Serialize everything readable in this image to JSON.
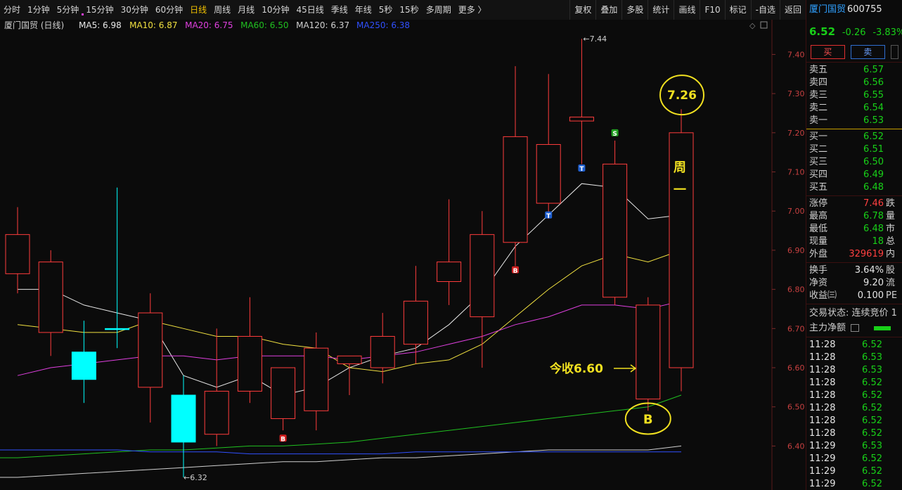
{
  "toolbar": {
    "periods": [
      "分时",
      "1分钟",
      "5分钟",
      "15分钟",
      "30分钟",
      "60分钟",
      "日线",
      "周线",
      "月线",
      "10分钟",
      "45日线",
      "季线",
      "年线",
      "5秒",
      "15秒",
      "多周期",
      "更多 〉"
    ],
    "active_period": "日线",
    "tools": [
      "复权",
      "叠加",
      "多股",
      "统计",
      "画线",
      "F10",
      "标记",
      "-自选",
      "返回"
    ]
  },
  "chart_header": {
    "title": "厦门国贸 (日线)",
    "ma": [
      {
        "label": "MA5: 6.98",
        "color": "#e8e8e8"
      },
      {
        "label": "MA10: 6.87",
        "color": "#f0e040"
      },
      {
        "label": "MA20: 6.75",
        "color": "#e040e0"
      },
      {
        "label": "MA60: 6.50",
        "color": "#20c020"
      },
      {
        "label": "MA120: 6.37",
        "color": "#d0d0d0"
      },
      {
        "label": "MA250: 6.38",
        "color": "#3050ff"
      }
    ]
  },
  "chart_data": {
    "type": "candlestick",
    "y_ticks": [
      "7.40",
      "7.30",
      "7.20",
      "7.10",
      "7.00",
      "6.90",
      "6.80",
      "6.70",
      "6.60",
      "6.50",
      "6.40"
    ],
    "ylim": [
      6.32,
      7.46
    ],
    "candles": [
      {
        "o": 6.84,
        "h": 7.01,
        "l": 6.79,
        "c": 6.94
      },
      {
        "o": 6.69,
        "h": 6.9,
        "l": 6.63,
        "c": 6.87
      },
      {
        "o": 6.64,
        "h": 6.72,
        "l": 6.51,
        "c": 6.57
      },
      {
        "o": 6.7,
        "h": 7.06,
        "l": 6.65,
        "c": 6.7
      },
      {
        "o": 6.55,
        "h": 6.79,
        "l": 6.46,
        "c": 6.74
      },
      {
        "o": 6.53,
        "h": 6.58,
        "l": 6.32,
        "c": 6.41
      },
      {
        "o": 6.43,
        "h": 6.7,
        "l": 6.4,
        "c": 6.54
      },
      {
        "o": 6.54,
        "h": 6.78,
        "l": 6.51,
        "c": 6.68
      },
      {
        "o": 6.47,
        "h": 6.6,
        "l": 6.44,
        "c": 6.6
      },
      {
        "o": 6.49,
        "h": 6.69,
        "l": 6.44,
        "c": 6.65
      },
      {
        "o": 6.61,
        "h": 6.63,
        "l": 6.53,
        "c": 6.63
      },
      {
        "o": 6.6,
        "h": 6.74,
        "l": 6.56,
        "c": 6.68
      },
      {
        "o": 6.66,
        "h": 6.86,
        "l": 6.61,
        "c": 6.77
      },
      {
        "o": 6.82,
        "h": 7.03,
        "l": 6.76,
        "c": 6.87
      },
      {
        "o": 6.73,
        "h": 7.0,
        "l": 6.6,
        "c": 6.94
      },
      {
        "o": 6.92,
        "h": 7.37,
        "l": 6.86,
        "c": 7.19
      },
      {
        "o": 7.02,
        "h": 7.35,
        "l": 6.98,
        "c": 7.17
      },
      {
        "o": 7.23,
        "h": 7.44,
        "l": 7.12,
        "c": 7.24
      },
      {
        "o": 6.78,
        "h": 7.18,
        "l": 6.76,
        "c": 7.12
      },
      {
        "o": 6.52,
        "h": 6.78,
        "l": 6.49,
        "c": 6.76
      },
      {
        "o": 6.6,
        "h": 7.26,
        "l": 6.54,
        "c": 7.2
      }
    ],
    "ma_series": [
      {
        "name": "MA5",
        "color": "#e8e8e8",
        "values": [
          6.8,
          6.8,
          6.76,
          6.74,
          6.72,
          6.58,
          6.55,
          6.58,
          6.53,
          6.55,
          6.6,
          6.63,
          6.65,
          6.71,
          6.79,
          6.91,
          6.99,
          7.07,
          7.06,
          6.98,
          6.99
        ]
      },
      {
        "name": "MA10",
        "color": "#f0e040",
        "values": [
          6.71,
          6.7,
          6.69,
          6.69,
          6.72,
          6.7,
          6.68,
          6.68,
          6.66,
          6.65,
          6.6,
          6.59,
          6.61,
          6.62,
          6.66,
          6.73,
          6.8,
          6.86,
          6.89,
          6.87,
          6.9
        ]
      },
      {
        "name": "MA20",
        "color": "#e040e0",
        "values": [
          6.58,
          6.6,
          6.61,
          6.62,
          6.63,
          6.63,
          6.62,
          6.63,
          6.63,
          6.63,
          6.62,
          6.63,
          6.64,
          6.66,
          6.68,
          6.71,
          6.73,
          6.76,
          6.76,
          6.75,
          6.77
        ]
      },
      {
        "name": "MA60",
        "color": "#20c020",
        "values": [
          6.37,
          6.375,
          6.38,
          6.385,
          6.39,
          6.39,
          6.395,
          6.4,
          6.4,
          6.405,
          6.41,
          6.42,
          6.43,
          6.44,
          6.45,
          6.46,
          6.47,
          6.48,
          6.49,
          6.5,
          6.53
        ]
      },
      {
        "name": "MA120",
        "color": "#d0d0d0",
        "values": [
          6.32,
          6.325,
          6.33,
          6.335,
          6.34,
          6.345,
          6.35,
          6.355,
          6.36,
          6.36,
          6.365,
          6.37,
          6.37,
          6.375,
          6.38,
          6.385,
          6.39,
          6.39,
          6.39,
          6.39,
          6.4
        ]
      },
      {
        "name": "MA250",
        "color": "#3050ff",
        "values": [
          6.39,
          6.39,
          6.39,
          6.39,
          6.385,
          6.385,
          6.385,
          6.38,
          6.38,
          6.38,
          6.38,
          6.38,
          6.385,
          6.385,
          6.385,
          6.385,
          6.385,
          6.385,
          6.385,
          6.385,
          6.385
        ]
      }
    ],
    "markers": [
      {
        "candle": 8,
        "price": 6.42,
        "text": "B",
        "bg": "#d02020"
      },
      {
        "candle": 15,
        "price": 6.85,
        "text": "B",
        "bg": "#d02020"
      },
      {
        "candle": 16,
        "price": 6.99,
        "text": "T",
        "bg": "#2060d0"
      },
      {
        "candle": 17,
        "price": 7.11,
        "text": "T",
        "bg": "#2060d0"
      },
      {
        "candle": 18,
        "price": 7.2,
        "text": "S",
        "bg": "#20a020"
      }
    ],
    "labels": {
      "high": "7.44",
      "low": "6.32",
      "target_price": "7.26",
      "today_close": "今收6.60",
      "buy_mark": "B",
      "weekday": "周一"
    },
    "annotation_color": "#f0e020"
  },
  "quote": {
    "name": "厦门国贸",
    "code": "600755",
    "price": "6.52",
    "change": "-0.26",
    "change_pct": "-3.83%",
    "buy_label": "买",
    "sell_label": "卖",
    "asks": [
      {
        "label": "卖五",
        "price": "6.57"
      },
      {
        "label": "卖四",
        "price": "6.56"
      },
      {
        "label": "卖三",
        "price": "6.55"
      },
      {
        "label": "卖二",
        "price": "6.54"
      },
      {
        "label": "卖一",
        "price": "6.53"
      }
    ],
    "bids": [
      {
        "label": "买一",
        "price": "6.52"
      },
      {
        "label": "买二",
        "price": "6.51"
      },
      {
        "label": "买三",
        "price": "6.50"
      },
      {
        "label": "买四",
        "price": "6.49"
      },
      {
        "label": "买五",
        "price": "6.48"
      }
    ],
    "stats": [
      {
        "label": "涨停",
        "value": "7.46",
        "color": "#ff4040",
        "extra": "跌"
      },
      {
        "label": "最高",
        "value": "6.78",
        "color": "#18d018",
        "extra": "量"
      },
      {
        "label": "最低",
        "value": "6.48",
        "color": "#18d018",
        "extra": "市"
      },
      {
        "label": "现量",
        "value": "18",
        "color": "#18d018",
        "extra": "总"
      },
      {
        "label": "外盘",
        "value": "329619",
        "color": "#ff4040",
        "extra": "内"
      }
    ],
    "stats2": [
      {
        "label": "换手",
        "value": "3.64%",
        "extra": "股"
      },
      {
        "label": "净资",
        "value": "9.20",
        "extra": "流"
      },
      {
        "label": "收益㈢",
        "value": "0.100",
        "extra": "PE"
      }
    ],
    "trade_state": "交易状态: 连续竞价 1",
    "main_flow": "主力净额",
    "ticks": [
      {
        "t": "11:28",
        "v": "6.52"
      },
      {
        "t": "11:28",
        "v": "6.53"
      },
      {
        "t": "11:28",
        "v": "6.53"
      },
      {
        "t": "11:28",
        "v": "6.52"
      },
      {
        "t": "11:28",
        "v": "6.52"
      },
      {
        "t": "11:28",
        "v": "6.52"
      },
      {
        "t": "11:28",
        "v": "6.52"
      },
      {
        "t": "11:28",
        "v": "6.52"
      },
      {
        "t": "11:29",
        "v": "6.53"
      },
      {
        "t": "11:29",
        "v": "6.52"
      },
      {
        "t": "11:29",
        "v": "6.52"
      },
      {
        "t": "11:29",
        "v": "6.52"
      }
    ]
  }
}
